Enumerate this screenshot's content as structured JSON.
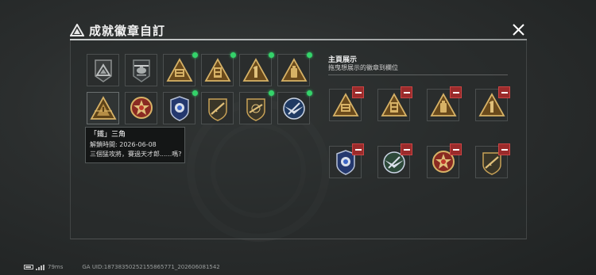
{
  "window": {
    "title": "成就徽章自訂"
  },
  "close_icon": "close-x-icon",
  "colors": {
    "new_dot": "#34d36a",
    "remove": "#9b2b2b",
    "gold": "#c8a257",
    "accent_red": "#c0392b",
    "blue": "#3b64c4"
  },
  "collection": {
    "badges": [
      {
        "icon": "gray-triangle-badge",
        "new": false,
        "selected": false
      },
      {
        "icon": "helicopter-badge",
        "new": false,
        "selected": false
      },
      {
        "icon": "gold-supply-triangle-badge",
        "new": true,
        "selected": false
      },
      {
        "icon": "gold-tower-triangle-badge",
        "new": true,
        "selected": false
      },
      {
        "icon": "gold-number-one-triangle-badge",
        "new": true,
        "selected": false
      },
      {
        "icon": "gold-canister-triangle-badge",
        "new": true,
        "selected": false
      },
      {
        "icon": "gold-hazard-triangle-badge",
        "new": false,
        "selected": true
      },
      {
        "icon": "red-gold-star-medal-badge",
        "new": false,
        "selected": false
      },
      {
        "icon": "blue-police-shield-badge",
        "new": true,
        "selected": false
      },
      {
        "icon": "rifle-shield-badge",
        "new": false,
        "selected": false
      },
      {
        "icon": "rifle-shield-crest-badge",
        "new": true,
        "selected": false
      },
      {
        "icon": "blue-wings-crest-badge",
        "new": true,
        "selected": false
      }
    ]
  },
  "tooltip": {
    "title": "「鐵」三角",
    "unlock_label": "解鎖時間:",
    "unlock_date": "2026-06-08",
    "description": "三個猛攻將，賽過天才郎......嗎?"
  },
  "showcase": {
    "title": "主頁展示",
    "subtitle": "拖曳想展示的徽章到欄位",
    "slots": [
      {
        "icon": "gold-supply-triangle-badge"
      },
      {
        "icon": "gold-tower-triangle-badge"
      },
      {
        "icon": "gold-canister-triangle-badge"
      },
      {
        "icon": "gold-number-one-triangle-badge"
      },
      {
        "icon": "blue-police-shield-badge"
      },
      {
        "icon": "blue-wings-crest-badge"
      },
      {
        "icon": "red-gold-star-medal-badge"
      },
      {
        "icon": "rifle-shield-badge"
      }
    ]
  },
  "status_bar": {
    "ping": "79ms",
    "uid": "GA UID:187383502521558657​71_202606081542"
  }
}
